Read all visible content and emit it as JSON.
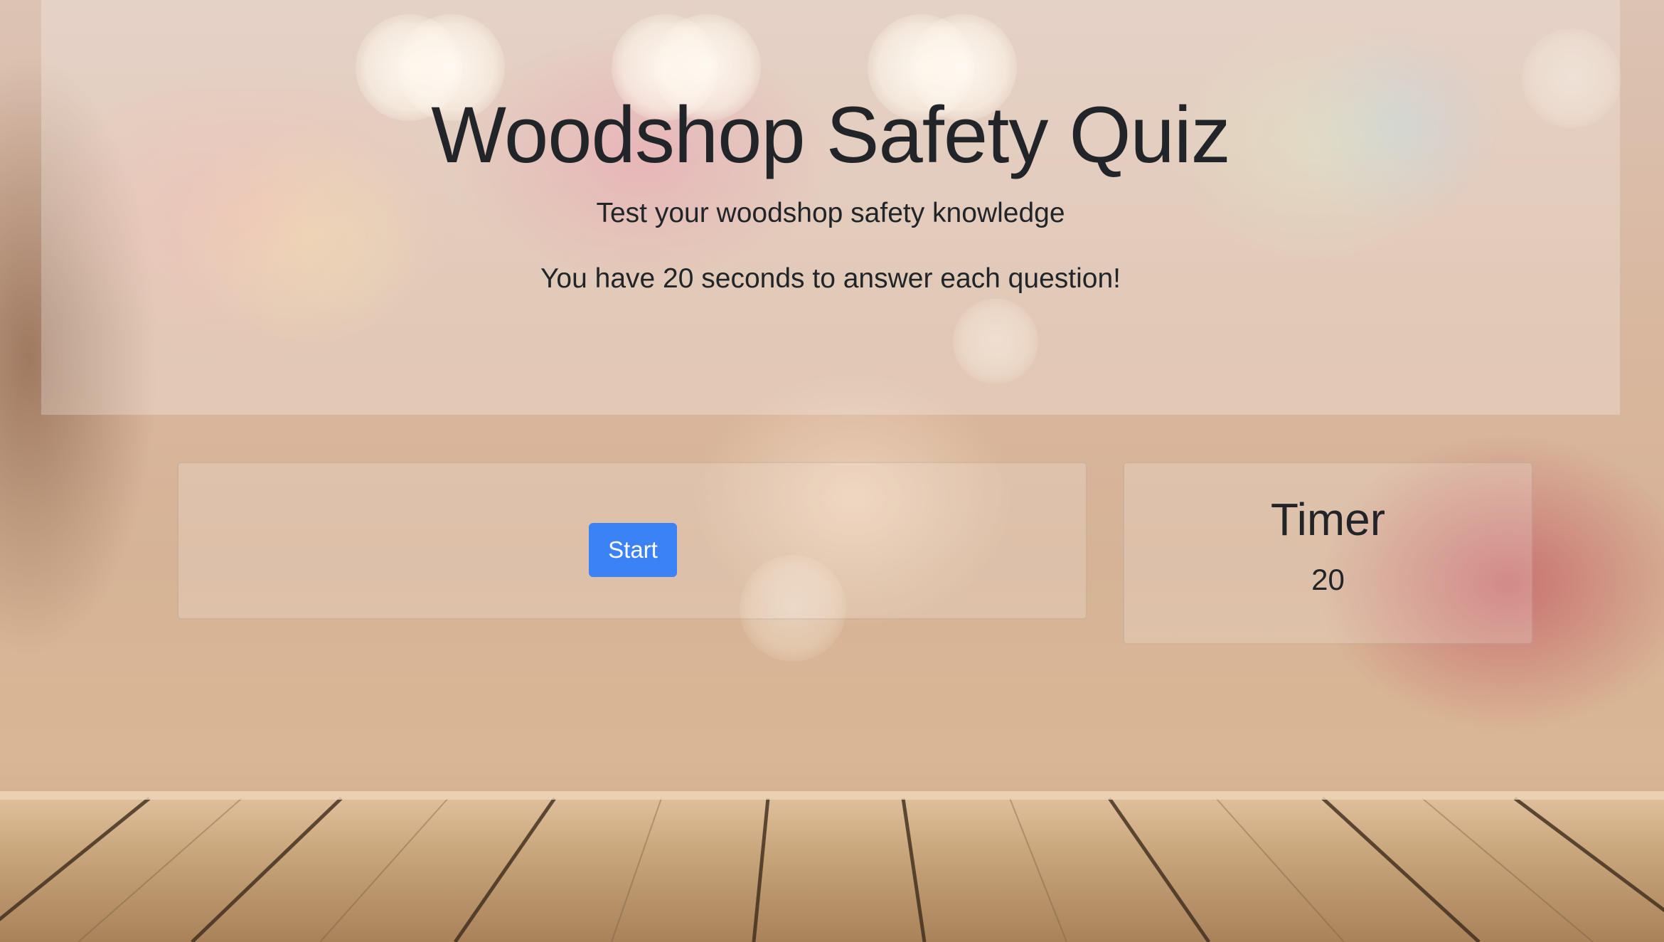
{
  "header": {
    "title": "Woodshop Safety Quiz",
    "subtitle": "Test your woodshop safety knowledge",
    "rule": "You have 20 seconds to answer each question!"
  },
  "quiz": {
    "start_label": "Start"
  },
  "timer": {
    "title": "Timer",
    "value": "20"
  },
  "colors": {
    "primary_button": "#3b82f6",
    "text": "#212529"
  }
}
